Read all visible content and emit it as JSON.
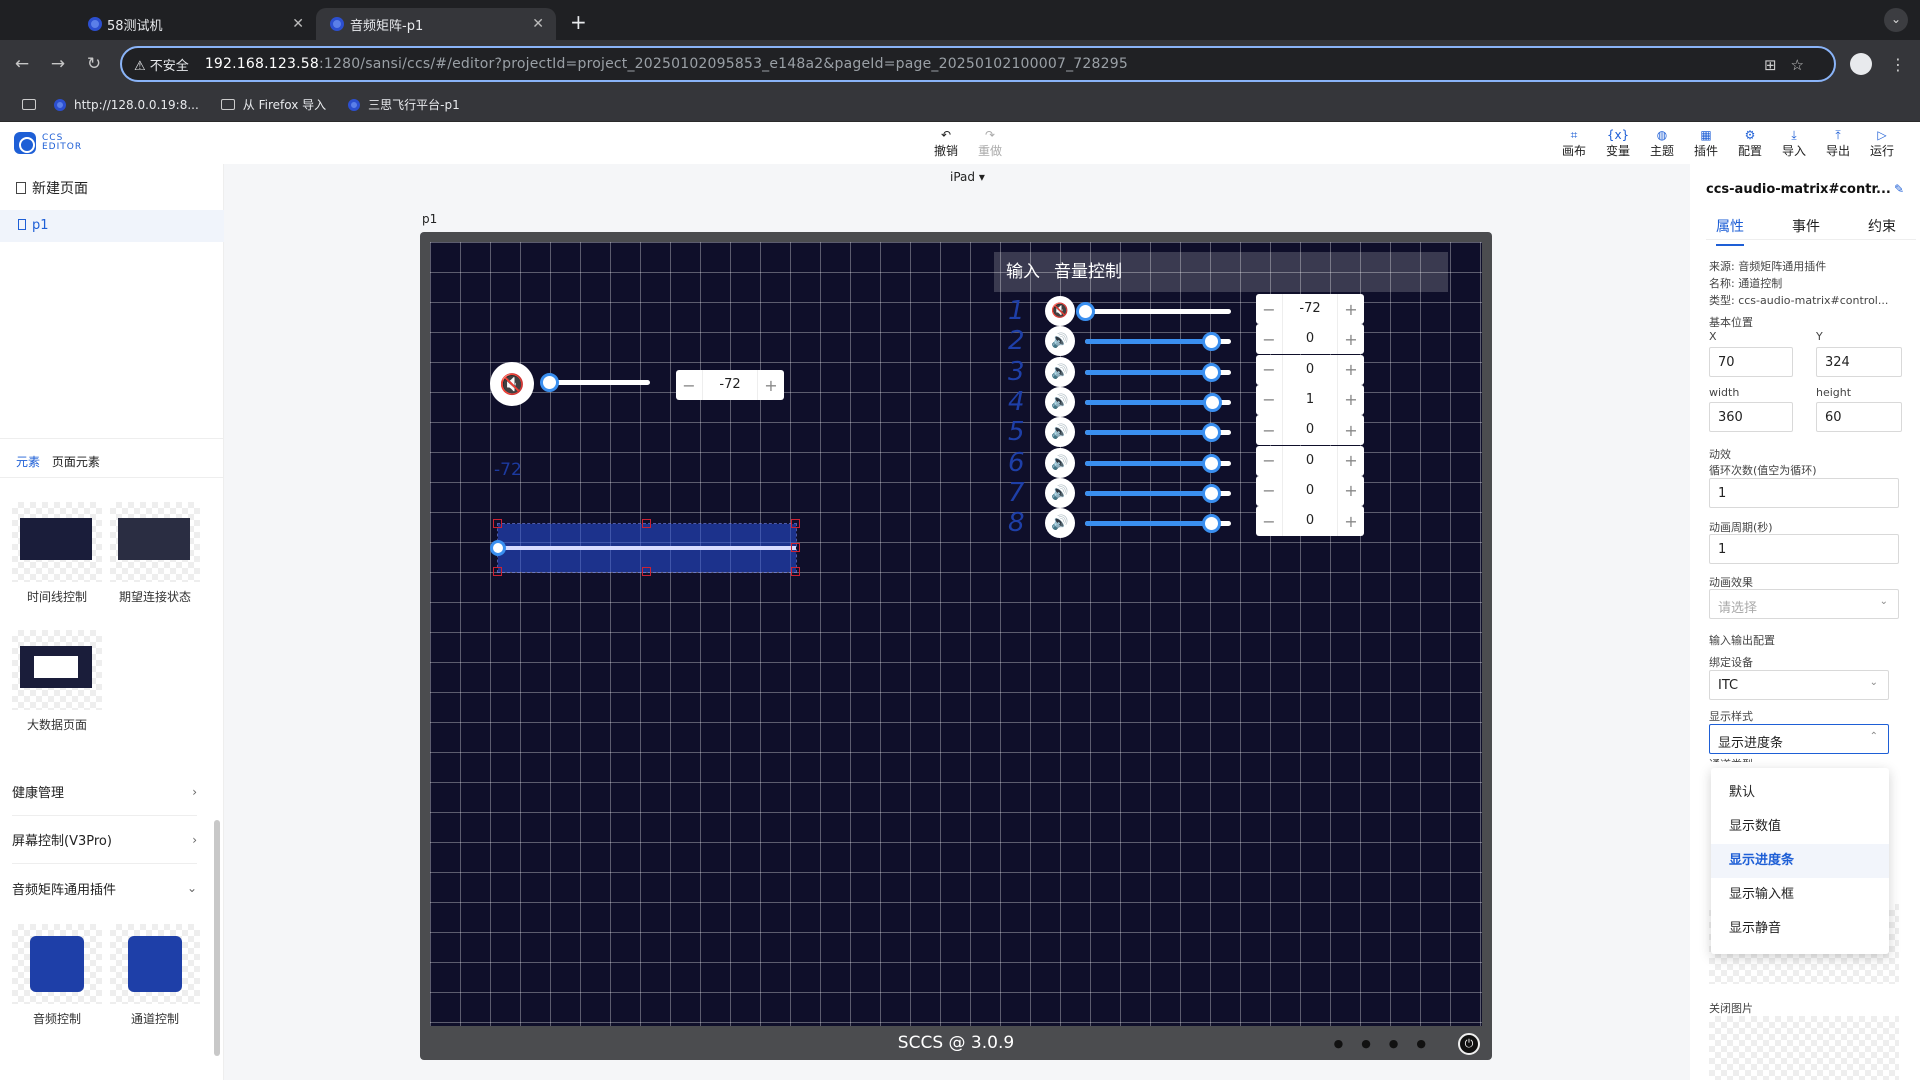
{
  "browser": {
    "tabs": [
      {
        "title": "58测试机",
        "active": false
      },
      {
        "title": "音频矩阵-p1",
        "active": true
      }
    ],
    "security_label": "不安全",
    "url_host": "192.168.123.58",
    "url_rest": ":1280/sansi/ccs/#/editor?projectId=project_20250102095853_e148a2&pageId=page_20250102100007_728295",
    "bookmarks": [
      "http://128.0.0.19:8...",
      "从 Firefox 导入",
      "三思飞行平台-p1"
    ]
  },
  "app": {
    "logo_line1": "CCS",
    "logo_line2": "EDITOR",
    "undo": "撤销",
    "redo": "重做",
    "tools": [
      "画布",
      "变量",
      "主题",
      "插件",
      "配置",
      "导入",
      "导出",
      "运行"
    ],
    "device": "iPad"
  },
  "left": {
    "new_page": "新建页面",
    "pages": [
      "p1"
    ],
    "element_tabs": [
      "元素",
      "页面元素"
    ],
    "thumbs_top": [
      "时间线控制",
      "期望连接状态",
      "大数据页面"
    ],
    "accordions": [
      "健康管理",
      "屏幕控制(V3Pro)",
      "音频矩阵通用插件"
    ],
    "thumbs_bottom": [
      "音频控制",
      "通道控制"
    ]
  },
  "canvas": {
    "page_label": "p1",
    "footer": "SCCS @ 3.0.9",
    "matrix_header": [
      "输入",
      "音量控制"
    ],
    "rows": [
      {
        "idx": "1",
        "value": "-72",
        "muted": true,
        "level": 0.0
      },
      {
        "idx": "2",
        "value": "0",
        "muted": false,
        "level": 0.86
      },
      {
        "idx": "3",
        "value": "0",
        "muted": false,
        "level": 0.86
      },
      {
        "idx": "4",
        "value": "1",
        "muted": false,
        "level": 0.87
      },
      {
        "idx": "5",
        "value": "0",
        "muted": false,
        "level": 0.86
      },
      {
        "idx": "6",
        "value": "0",
        "muted": false,
        "level": 0.86
      },
      {
        "idx": "7",
        "value": "0",
        "muted": false,
        "level": 0.86
      },
      {
        "idx": "8",
        "value": "0",
        "muted": false,
        "level": 0.86
      }
    ],
    "single_value": "-72",
    "faint_value": "-72",
    "stepper_minus": "−",
    "stepper_plus": "+"
  },
  "right": {
    "title": "ccs-audio-matrix#contr...",
    "tabs": [
      "属性",
      "事件",
      "约束"
    ],
    "source": "来源: 音频矩阵通用插件",
    "name": "名称: 通道控制",
    "type": "类型: ccs-audio-matrix#control...",
    "basic_pos": "基本位置",
    "x_label": "X",
    "x": "70",
    "y_label": "Y",
    "y": "324",
    "w_label": "width",
    "w": "360",
    "h_label": "height",
    "h": "60",
    "anim": "动效",
    "loop_label": "循环次数(值空为循环)",
    "loop": "1",
    "period_label": "动画周期(秒)",
    "period": "1",
    "effect_label": "动画效果",
    "effect_placeholder": "请选择",
    "io": "输入输出配置",
    "device_label": "绑定设备",
    "device": "ITC",
    "style_label": "显示样式",
    "style": "显示进度条",
    "hidden_label": "通道类型",
    "options": [
      "默认",
      "显示数值",
      "显示进度条",
      "显示输入框",
      "显示静音"
    ],
    "selected_option": 2,
    "close_img": "关闭图片"
  }
}
